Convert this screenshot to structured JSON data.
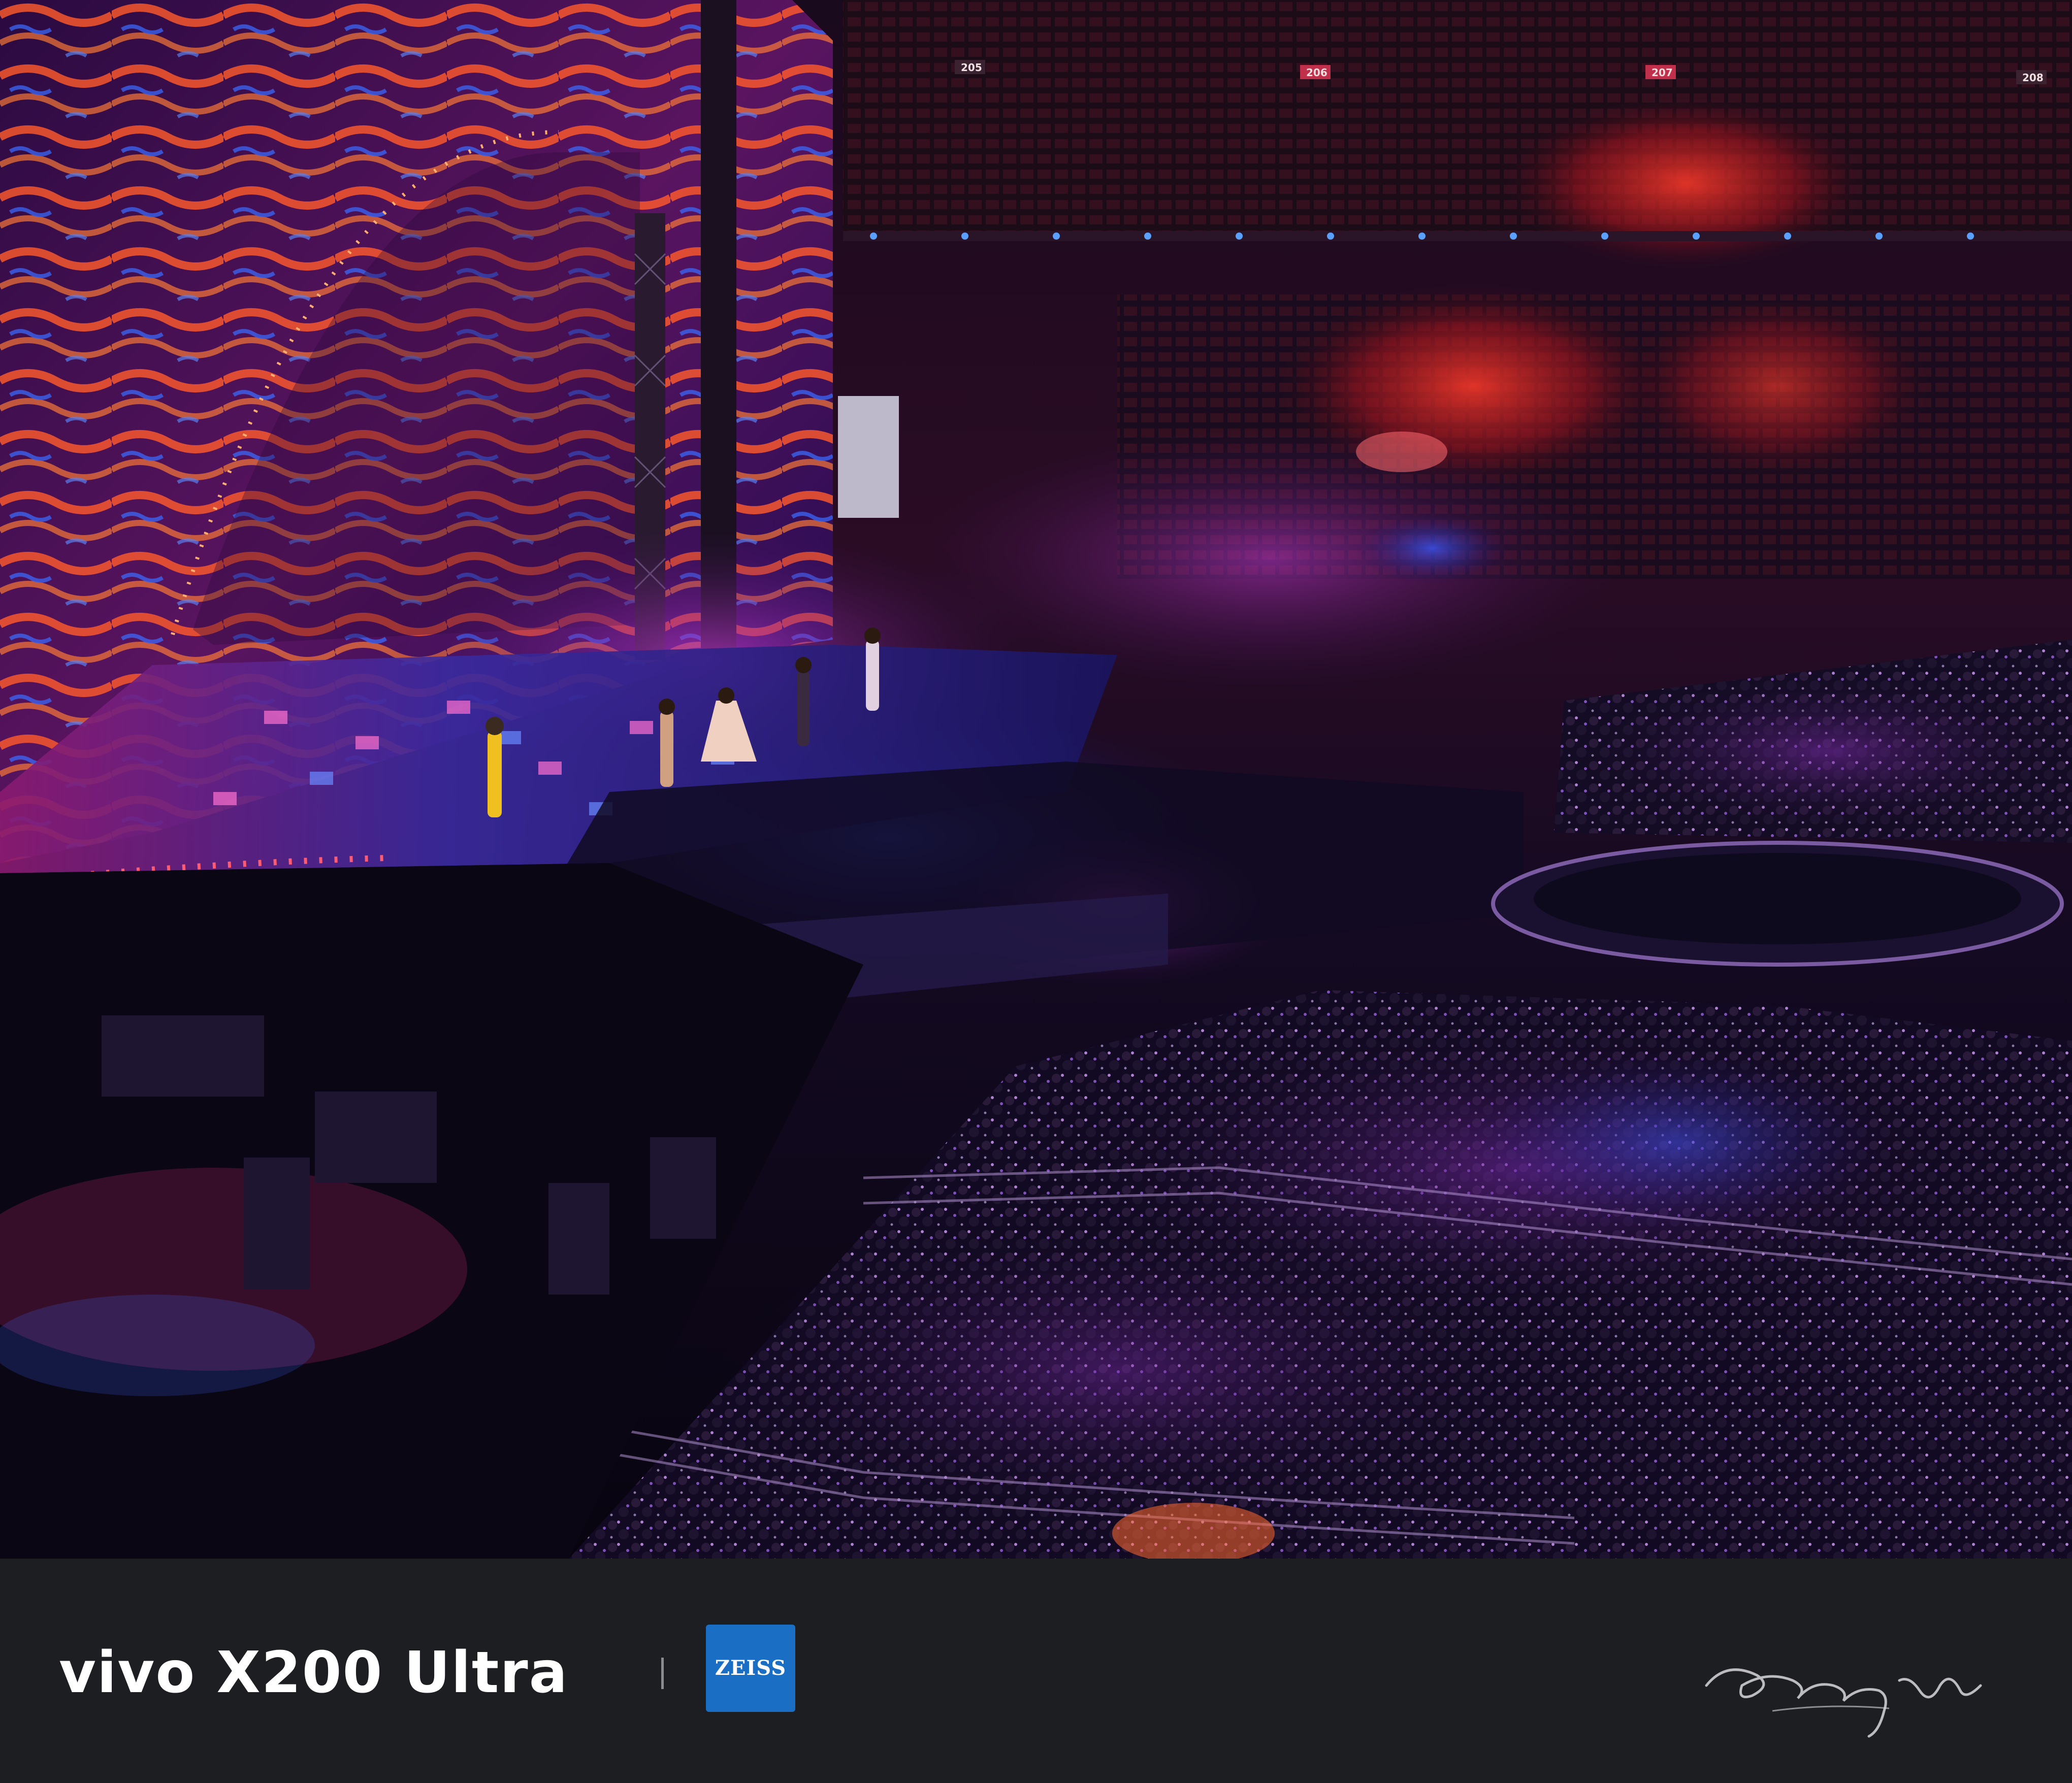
{
  "watermark": {
    "brand": "vivo X200 Ultra",
    "lens_brand": "ZEISS",
    "signature_icon": "handwritten-signature"
  },
  "colors": {
    "bar_background": "#1c1e22",
    "zeiss_blue": "#1a6fc4",
    "text": "#ffffff"
  },
  "photo": {
    "section_labels": [
      "205",
      "206",
      "207",
      "208"
    ]
  }
}
